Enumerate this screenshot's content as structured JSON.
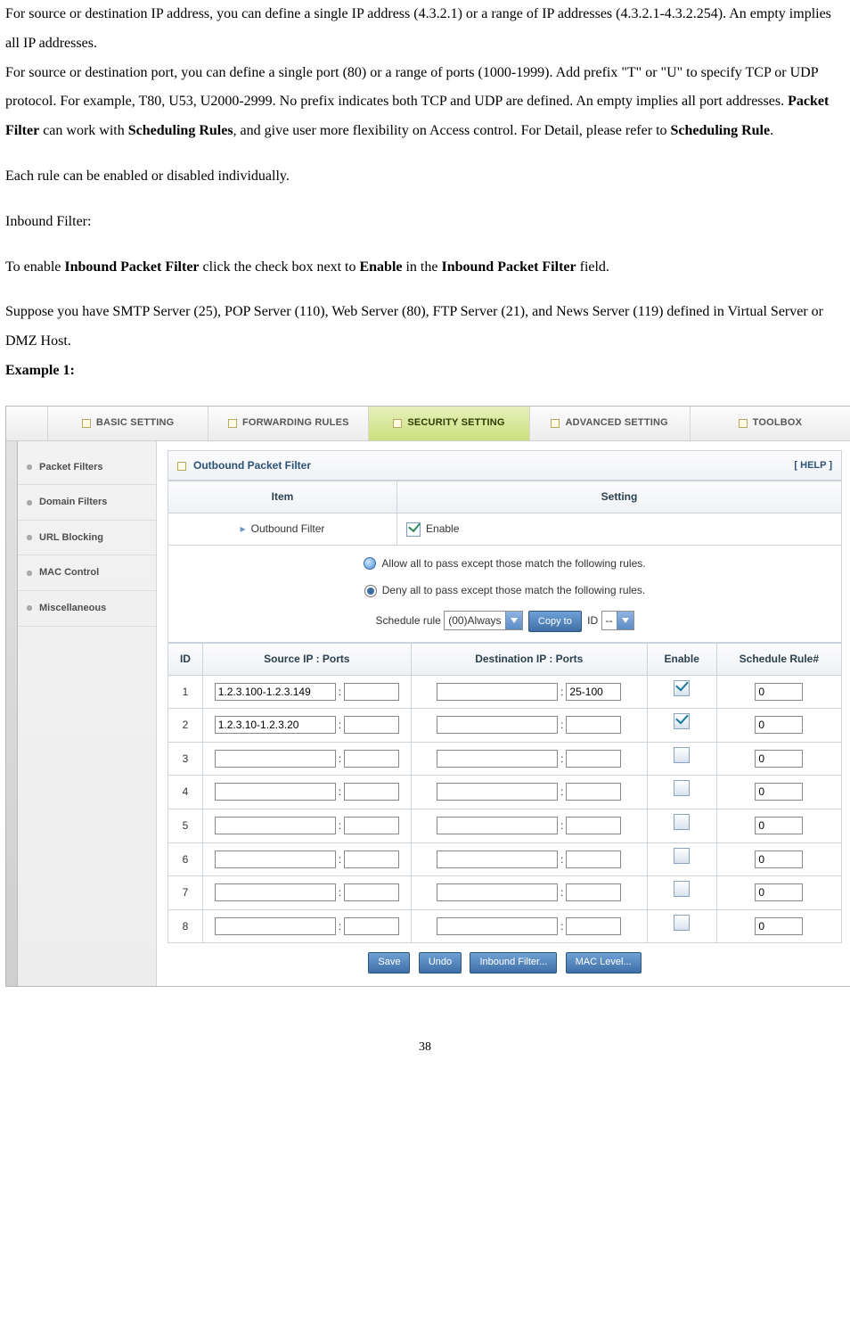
{
  "doc": {
    "para1a": "For source or destination IP address, you can define a single IP address (4.3.2.1) or a range of IP addresses (4.3.2.1-4.3.2.254). An empty implies all IP addresses.",
    "para1b_pre": "For source or destination port, you can define a single port (80) or a range of ports (1000-1999). Add prefix \"T\" or \"U\" to specify TCP or UDP protocol. For example, T80, U53, U2000-2999. No prefix indicates both TCP and UDP are defined. An empty implies all port addresses. ",
    "bold_pf": "Packet Filter",
    "para1b_mid": " can work with ",
    "bold_sr": "Scheduling Rules",
    "para1b_post": ", and give user more flexibility on Access control. For Detail, please refer to ",
    "bold_sr2": "Scheduling Rule",
    "para1b_end": ".",
    "para2": "Each rule can be enabled or disabled individually.",
    "para3": "Inbound Filter:",
    "para4_pre": "To enable ",
    "bold_ipf": "Inbound Packet Filter",
    "para4_mid": " click the check box next to ",
    "bold_enable": "Enable",
    "para4_mid2": " in the ",
    "bold_ipf2": "Inbound Packet Filter",
    "para4_post": " field.",
    "para5": "Suppose you have SMTP Server (25), POP Server (110), Web Server (80), FTP Server (21), and News Server (119) defined in Virtual Server or DMZ Host.",
    "example": "Example 1:",
    "page_num": "38"
  },
  "ui": {
    "topnav": {
      "basic": "BASIC SETTING",
      "fwd": "FORWARDING RULES",
      "sec": "SECURITY SETTING",
      "adv": "ADVANCED SETTING",
      "tool": "TOOLBOX"
    },
    "leftnav": {
      "pf": "Packet Filters",
      "df": "Domain Filters",
      "url": "URL Blocking",
      "mac": "MAC Control",
      "misc": "Miscellaneous"
    },
    "panel": {
      "title": "Outbound Packet Filter",
      "help": "[ HELP ]",
      "th_item": "Item",
      "th_setting": "Setting",
      "outbound_label": "Outbound Filter",
      "enable_label": "Enable",
      "allow_label": "Allow all to pass except those match the following rules.",
      "deny_label": "Deny all to pass except those match the following rules.",
      "sched_label": "Schedule rule",
      "sched_value": "(00)Always",
      "copy_btn": "Copy to",
      "id_label": "ID",
      "id_value": "--"
    },
    "cols": {
      "id": "ID",
      "src": "Source IP : Ports",
      "dst": "Destination IP : Ports",
      "en": "Enable",
      "rule": "Schedule Rule#"
    },
    "rows": [
      {
        "id": "1",
        "sip": "1.2.3.100-1.2.3.149",
        "sport": "",
        "dip": "",
        "dport": "25-100",
        "en": true,
        "rule": "0"
      },
      {
        "id": "2",
        "sip": "1.2.3.10-1.2.3.20",
        "sport": "",
        "dip": "",
        "dport": "",
        "en": true,
        "rule": "0"
      },
      {
        "id": "3",
        "sip": "",
        "sport": "",
        "dip": "",
        "dport": "",
        "en": false,
        "rule": "0"
      },
      {
        "id": "4",
        "sip": "",
        "sport": "",
        "dip": "",
        "dport": "",
        "en": false,
        "rule": "0"
      },
      {
        "id": "5",
        "sip": "",
        "sport": "",
        "dip": "",
        "dport": "",
        "en": false,
        "rule": "0"
      },
      {
        "id": "6",
        "sip": "",
        "sport": "",
        "dip": "",
        "dport": "",
        "en": false,
        "rule": "0"
      },
      {
        "id": "7",
        "sip": "",
        "sport": "",
        "dip": "",
        "dport": "",
        "en": false,
        "rule": "0"
      },
      {
        "id": "8",
        "sip": "",
        "sport": "",
        "dip": "",
        "dport": "",
        "en": false,
        "rule": "0"
      }
    ],
    "buttons": {
      "save": "Save",
      "undo": "Undo",
      "inbound": "Inbound Filter...",
      "mac": "MAC Level..."
    }
  }
}
